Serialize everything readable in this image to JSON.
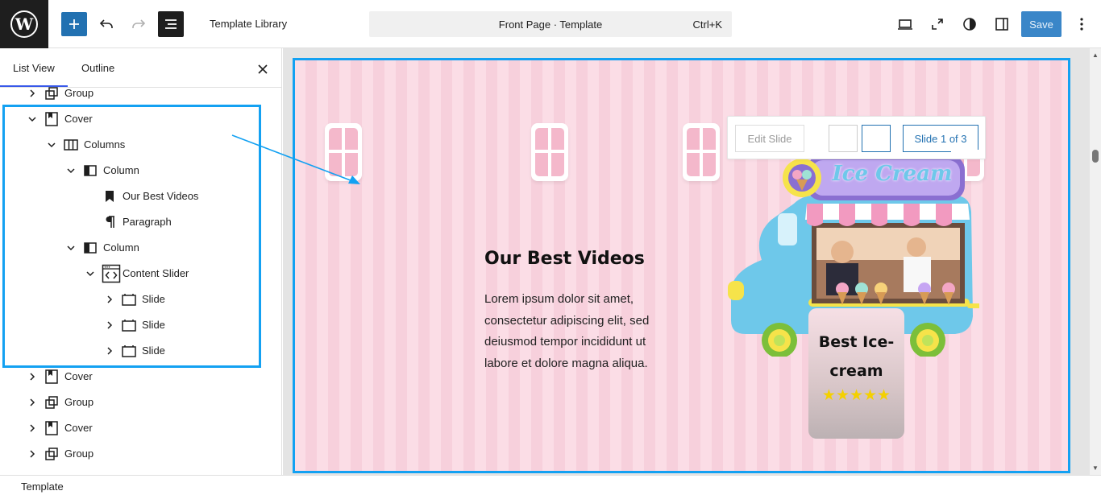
{
  "topbar": {
    "title": "Template Library",
    "command_title": "Front Page · Template",
    "command_shortcut": "Ctrl+K",
    "save_label": "Save"
  },
  "panel": {
    "tabs": [
      {
        "label": "List View",
        "active": true
      },
      {
        "label": "Outline",
        "active": false
      }
    ],
    "tree": [
      {
        "label": "Group",
        "icon": "group-icon",
        "expanded": false,
        "depth": 0
      },
      {
        "label": "Cover",
        "icon": "cover-icon",
        "expanded": true,
        "depth": 0
      },
      {
        "label": "Columns",
        "icon": "columns-icon",
        "expanded": true,
        "depth": 1
      },
      {
        "label": "Column",
        "icon": "column-icon",
        "expanded": true,
        "depth": 2
      },
      {
        "label": "Our Best Videos",
        "icon": "bookmark-icon",
        "depth": 3
      },
      {
        "label": "Paragraph",
        "icon": "paragraph-icon",
        "depth": 3
      },
      {
        "label": "Column",
        "icon": "column-icon",
        "expanded": true,
        "depth": 2
      },
      {
        "label": "Content Slider",
        "icon": "code-window-icon",
        "expanded": true,
        "depth": 3
      },
      {
        "label": "Slide",
        "icon": "slide-icon",
        "expanded": false,
        "depth": 4
      },
      {
        "label": "Slide",
        "icon": "slide-icon",
        "expanded": false,
        "depth": 4
      },
      {
        "label": "Slide",
        "icon": "slide-icon",
        "expanded": false,
        "depth": 4
      },
      {
        "label": "Cover",
        "icon": "cover-icon",
        "expanded": false,
        "depth": 0
      },
      {
        "label": "Group",
        "icon": "group-icon",
        "expanded": false,
        "depth": 0
      },
      {
        "label": "Cover",
        "icon": "cover-icon",
        "expanded": false,
        "depth": 0
      },
      {
        "label": "Group",
        "icon": "group-icon",
        "expanded": false,
        "depth": 0
      }
    ]
  },
  "canvas": {
    "heading": "Our Best Videos",
    "paragraph": "Lorem ipsum dolor sit amet, consectetur adipiscing elit, sed deiusmod tempor incididunt ut labore et dolore magna aliqua.",
    "slider_toolbar": {
      "edit_label": "Edit Slide",
      "count_label": "Slide 1 of 3"
    },
    "logo_text": "Ice Cream",
    "card_title_line1": "Best Ice-",
    "card_title_line2": "cream",
    "card_stars": "★★★★★",
    "rating": 5
  },
  "status": {
    "breadcrumb": "Template"
  },
  "colors": {
    "accent": "#2271b1",
    "selection": "#13a1f2",
    "cover_bg": "#fbdde6"
  }
}
